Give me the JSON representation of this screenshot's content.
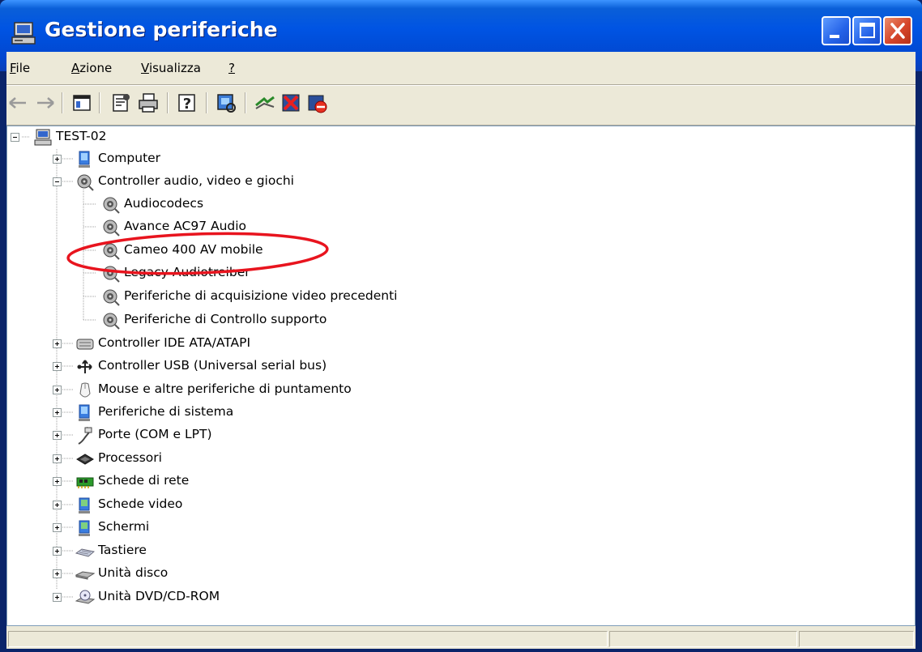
{
  "window": {
    "title": "Gestione periferiche",
    "title_icon": "computer-icon",
    "controls": [
      "minimize-icon",
      "maximize-icon",
      "close-icon"
    ]
  },
  "menu": [
    {
      "label_u": "F",
      "label_rest": "ile"
    },
    {
      "label_u": "A",
      "label_rest": "zione"
    },
    {
      "label_u": "V",
      "label_rest": "isualizza"
    },
    {
      "label_u": "?",
      "label_rest": ""
    }
  ],
  "toolbar": [
    "back-arrow-icon",
    "forward-arrow-icon",
    "show-hide-tree-icon",
    "properties-icon",
    "print-icon",
    "help-icon",
    "scan-hardware-icon",
    "update-driver-icon",
    "uninstall-icon",
    "disable-icon"
  ],
  "tree": {
    "root": "TEST-02",
    "categories": [
      {
        "label": "Computer",
        "icon": "computer-monitor-icon",
        "expanded": false
      },
      {
        "label": "Controller audio, video e giochi",
        "icon": "speaker-icon",
        "expanded": true,
        "children": [
          "Audiocodecs",
          "Avance AC97 Audio",
          "Cameo 400 AV mobile",
          "Legacy Audiotreiber",
          "Periferiche di acquisizione video precedenti",
          "Periferiche di Controllo supporto"
        ]
      },
      {
        "label": "Controller IDE ATA/ATAPI",
        "icon": "ide-controller-icon",
        "expanded": false
      },
      {
        "label": "Controller USB (Universal serial bus)",
        "icon": "usb-icon",
        "expanded": false
      },
      {
        "label": "Mouse e altre periferiche di puntamento",
        "icon": "mouse-icon",
        "expanded": false
      },
      {
        "label": "Periferiche di sistema",
        "icon": "system-device-icon",
        "expanded": false
      },
      {
        "label": "Porte (COM e LPT)",
        "icon": "port-icon",
        "expanded": false
      },
      {
        "label": "Processori",
        "icon": "processor-icon",
        "expanded": false
      },
      {
        "label": "Schede di rete",
        "icon": "network-card-icon",
        "expanded": false
      },
      {
        "label": "Schede video",
        "icon": "display-adapter-icon",
        "expanded": false
      },
      {
        "label": "Schermi",
        "icon": "monitor-icon",
        "expanded": false
      },
      {
        "label": "Tastiere",
        "icon": "keyboard-icon",
        "expanded": false
      },
      {
        "label": "Unità disco",
        "icon": "disk-drive-icon",
        "expanded": false
      },
      {
        "label": "Unità DVD/CD-ROM",
        "icon": "dvd-drive-icon",
        "expanded": false
      }
    ]
  },
  "annotation": {
    "highlighted_item": "Cameo 400 AV mobile",
    "color": "#e8141e"
  }
}
